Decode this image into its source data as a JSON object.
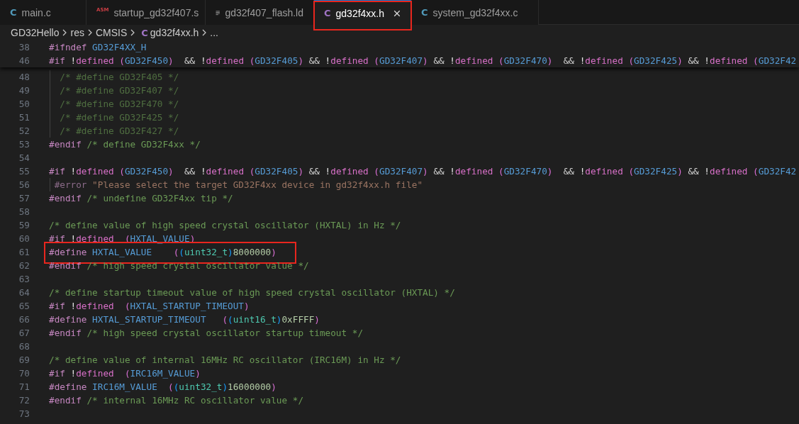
{
  "tabs": [
    {
      "kind": "c-source",
      "icon": "C",
      "label": "main.c",
      "selected": false,
      "annotated": false
    },
    {
      "kind": "asm",
      "icon": "ASM",
      "label": "startup_gd32f407.s",
      "selected": false,
      "annotated": false
    },
    {
      "kind": "linker",
      "label": "gd32f407_flash.ld",
      "selected": false,
      "annotated": false
    },
    {
      "kind": "c-header",
      "icon": "C",
      "label": "gd32f4xx.h",
      "selected": true,
      "annotated": true
    },
    {
      "kind": "c-source",
      "icon": "C",
      "label": "system_gd32f4xx.c",
      "selected": false,
      "annotated": false
    }
  ],
  "breadcrumb": [
    {
      "label": "GD32Hello"
    },
    {
      "label": "res"
    },
    {
      "label": "CMSIS"
    },
    {
      "icon": "C",
      "label": "gd32f4xx.h"
    },
    {
      "label": "..."
    }
  ],
  "sticky_lines": [
    {
      "number": "38",
      "tokens": [
        {
          "kind": "pp",
          "text": "#ifndef "
        },
        {
          "kind": "macro",
          "text": "GD32F4XX_H"
        }
      ]
    },
    {
      "number": "46",
      "tokens": [
        {
          "kind": "pp",
          "text": "#if "
        },
        {
          "kind": "not",
          "text": "!"
        },
        {
          "kind": "fn",
          "text": "defined "
        },
        {
          "kind": "paren",
          "text": "("
        },
        {
          "kind": "macro",
          "text": "GD32F450"
        },
        {
          "kind": "paren",
          "text": ")"
        },
        {
          "kind": "op",
          "text": "  && "
        },
        {
          "kind": "not",
          "text": "!"
        },
        {
          "kind": "fn",
          "text": "defined "
        },
        {
          "kind": "paren",
          "text": "("
        },
        {
          "kind": "macro",
          "text": "GD32F405"
        },
        {
          "kind": "paren",
          "text": ")"
        },
        {
          "kind": "op",
          "text": " && "
        },
        {
          "kind": "not",
          "text": "!"
        },
        {
          "kind": "fn",
          "text": "defined "
        },
        {
          "kind": "paren",
          "text": "("
        },
        {
          "kind": "macro",
          "text": "GD32F407"
        },
        {
          "kind": "paren",
          "text": ")"
        },
        {
          "kind": "op",
          "text": " && "
        },
        {
          "kind": "not",
          "text": "!"
        },
        {
          "kind": "fn",
          "text": "defined "
        },
        {
          "kind": "paren",
          "text": "("
        },
        {
          "kind": "macro",
          "text": "GD32F470"
        },
        {
          "kind": "paren",
          "text": ")"
        },
        {
          "kind": "op",
          "text": "  && "
        },
        {
          "kind": "not",
          "text": "!"
        },
        {
          "kind": "fn",
          "text": "defined "
        },
        {
          "kind": "paren",
          "text": "("
        },
        {
          "kind": "macro",
          "text": "GD32F425"
        },
        {
          "kind": "paren",
          "text": ")"
        },
        {
          "kind": "op",
          "text": " && "
        },
        {
          "kind": "not",
          "text": "!"
        },
        {
          "kind": "fn",
          "text": "defined "
        },
        {
          "kind": "paren",
          "text": "("
        },
        {
          "kind": "macro",
          "text": "GD32F42"
        }
      ]
    }
  ],
  "lines": [
    {
      "number": "48",
      "indent_guide": true,
      "annotated": false,
      "tokens": [
        {
          "kind": "inactive-comment",
          "text": "  /* #define GD32F405 */"
        }
      ]
    },
    {
      "number": "49",
      "indent_guide": true,
      "annotated": false,
      "tokens": [
        {
          "kind": "inactive-comment",
          "text": "  /* #define GD32F407 */"
        }
      ]
    },
    {
      "number": "50",
      "indent_guide": true,
      "annotated": false,
      "tokens": [
        {
          "kind": "inactive-comment",
          "text": "  /* #define GD32F470 */"
        }
      ]
    },
    {
      "number": "51",
      "indent_guide": true,
      "annotated": false,
      "tokens": [
        {
          "kind": "inactive-comment",
          "text": "  /* #define GD32F425 */"
        }
      ]
    },
    {
      "number": "52",
      "indent_guide": true,
      "annotated": false,
      "tokens": [
        {
          "kind": "inactive-comment",
          "text": "  /* #define GD32F427 */"
        }
      ]
    },
    {
      "number": "53",
      "indent_guide": false,
      "annotated": false,
      "tokens": [
        {
          "kind": "pp",
          "text": "#endif "
        },
        {
          "kind": "comment",
          "text": "/* define GD32F4xx */"
        }
      ]
    },
    {
      "number": "54"
    },
    {
      "number": "55",
      "indent_guide": false,
      "annotated": false,
      "tokens": [
        {
          "kind": "pp",
          "text": "#if "
        },
        {
          "kind": "not",
          "text": "!"
        },
        {
          "kind": "fn",
          "text": "defined "
        },
        {
          "kind": "paren",
          "text": "("
        },
        {
          "kind": "macro",
          "text": "GD32F450"
        },
        {
          "kind": "paren",
          "text": ")"
        },
        {
          "kind": "op",
          "text": "  && "
        },
        {
          "kind": "not",
          "text": "!"
        },
        {
          "kind": "fn",
          "text": "defined "
        },
        {
          "kind": "paren",
          "text": "("
        },
        {
          "kind": "macro",
          "text": "GD32F405"
        },
        {
          "kind": "paren",
          "text": ")"
        },
        {
          "kind": "op",
          "text": " && "
        },
        {
          "kind": "not",
          "text": "!"
        },
        {
          "kind": "fn",
          "text": "defined "
        },
        {
          "kind": "paren",
          "text": "("
        },
        {
          "kind": "macro",
          "text": "GD32F407"
        },
        {
          "kind": "paren",
          "text": ")"
        },
        {
          "kind": "op",
          "text": " && "
        },
        {
          "kind": "not",
          "text": "!"
        },
        {
          "kind": "fn",
          "text": "defined "
        },
        {
          "kind": "paren",
          "text": "("
        },
        {
          "kind": "macro",
          "text": "GD32F470"
        },
        {
          "kind": "paren",
          "text": ")"
        },
        {
          "kind": "op",
          "text": "  && "
        },
        {
          "kind": "not",
          "text": "!"
        },
        {
          "kind": "fn",
          "text": "defined "
        },
        {
          "kind": "paren",
          "text": "("
        },
        {
          "kind": "macro",
          "text": "GD32F425"
        },
        {
          "kind": "paren",
          "text": ")"
        },
        {
          "kind": "op",
          "text": " && "
        },
        {
          "kind": "not",
          "text": "!"
        },
        {
          "kind": "fn",
          "text": "defined "
        },
        {
          "kind": "paren",
          "text": "("
        },
        {
          "kind": "macro",
          "text": "GD32F42"
        }
      ]
    },
    {
      "number": "56",
      "indent_guide": true,
      "annotated": false,
      "tokens": [
        {
          "kind": "inactive-pp",
          "text": " #error "
        },
        {
          "kind": "inactive-string",
          "text": "\"Please select the target GD32F4xx device in gd32f4xx.h file\""
        }
      ]
    },
    {
      "number": "57",
      "indent_guide": false,
      "annotated": false,
      "tokens": [
        {
          "kind": "pp",
          "text": "#endif "
        },
        {
          "kind": "comment",
          "text": "/* undefine GD32F4xx tip */"
        }
      ]
    },
    {
      "number": "58"
    },
    {
      "number": "59",
      "indent_guide": false,
      "annotated": false,
      "tokens": [
        {
          "kind": "comment",
          "text": "/* define value of high speed crystal oscillator (HXTAL) in Hz */"
        }
      ]
    },
    {
      "number": "60",
      "indent_guide": false,
      "annotated": false,
      "tokens": [
        {
          "kind": "pp",
          "text": "#if "
        },
        {
          "kind": "not",
          "text": "!"
        },
        {
          "kind": "fn",
          "text": "defined  "
        },
        {
          "kind": "paren",
          "text": "("
        },
        {
          "kind": "macro",
          "text": "HXTAL_VALUE"
        },
        {
          "kind": "paren",
          "text": ")"
        }
      ]
    },
    {
      "number": "61",
      "indent_guide": false,
      "annotated": true,
      "tokens": [
        {
          "kind": "pp",
          "text": "#define "
        },
        {
          "kind": "macro",
          "text": "HXTAL_VALUE    "
        },
        {
          "kind": "paren",
          "text": "("
        },
        {
          "kind": "paren2",
          "text": "("
        },
        {
          "kind": "type",
          "text": "uint32_t"
        },
        {
          "kind": "paren2",
          "text": ")"
        },
        {
          "kind": "num",
          "text": "8000000"
        },
        {
          "kind": "paren",
          "text": ")"
        }
      ]
    },
    {
      "number": "62",
      "indent_guide": false,
      "annotated": false,
      "tokens": [
        {
          "kind": "pp",
          "text": "#endif "
        },
        {
          "kind": "comment",
          "text": "/* high speed crystal oscillator value */"
        }
      ]
    },
    {
      "number": "63"
    },
    {
      "number": "64",
      "indent_guide": false,
      "annotated": false,
      "tokens": [
        {
          "kind": "comment",
          "text": "/* define startup timeout value of high speed crystal oscillator (HXTAL) */"
        }
      ]
    },
    {
      "number": "65",
      "indent_guide": false,
      "annotated": false,
      "tokens": [
        {
          "kind": "pp",
          "text": "#if "
        },
        {
          "kind": "not",
          "text": "!"
        },
        {
          "kind": "fn",
          "text": "defined  "
        },
        {
          "kind": "paren",
          "text": "("
        },
        {
          "kind": "macro",
          "text": "HXTAL_STARTUP_TIMEOUT"
        },
        {
          "kind": "paren",
          "text": ")"
        }
      ]
    },
    {
      "number": "66",
      "indent_guide": false,
      "annotated": false,
      "tokens": [
        {
          "kind": "pp",
          "text": "#define "
        },
        {
          "kind": "macro",
          "text": "HXTAL_STARTUP_TIMEOUT   "
        },
        {
          "kind": "paren",
          "text": "("
        },
        {
          "kind": "paren2",
          "text": "("
        },
        {
          "kind": "type",
          "text": "uint16_t"
        },
        {
          "kind": "paren2",
          "text": ")"
        },
        {
          "kind": "num",
          "text": "0xFFFF"
        },
        {
          "kind": "paren",
          "text": ")"
        }
      ]
    },
    {
      "number": "67",
      "indent_guide": false,
      "annotated": false,
      "tokens": [
        {
          "kind": "pp",
          "text": "#endif "
        },
        {
          "kind": "comment",
          "text": "/* high speed crystal oscillator startup timeout */"
        }
      ]
    },
    {
      "number": "68"
    },
    {
      "number": "69",
      "indent_guide": false,
      "annotated": false,
      "tokens": [
        {
          "kind": "comment",
          "text": "/* define value of internal 16MHz RC oscillator (IRC16M) in Hz */"
        }
      ]
    },
    {
      "number": "70",
      "indent_guide": false,
      "annotated": false,
      "tokens": [
        {
          "kind": "pp",
          "text": "#if "
        },
        {
          "kind": "not",
          "text": "!"
        },
        {
          "kind": "fn",
          "text": "defined  "
        },
        {
          "kind": "paren",
          "text": "("
        },
        {
          "kind": "macro",
          "text": "IRC16M_VALUE"
        },
        {
          "kind": "paren",
          "text": ")"
        }
      ]
    },
    {
      "number": "71",
      "indent_guide": false,
      "annotated": false,
      "tokens": [
        {
          "kind": "pp",
          "text": "#define "
        },
        {
          "kind": "macro",
          "text": "IRC16M_VALUE  "
        },
        {
          "kind": "paren",
          "text": "("
        },
        {
          "kind": "paren2",
          "text": "("
        },
        {
          "kind": "type",
          "text": "uint32_t"
        },
        {
          "kind": "paren2",
          "text": ")"
        },
        {
          "kind": "num",
          "text": "16000000"
        },
        {
          "kind": "paren",
          "text": ")"
        }
      ]
    },
    {
      "number": "72",
      "indent_guide": false,
      "annotated": false,
      "tokens": [
        {
          "kind": "pp",
          "text": "#endif "
        },
        {
          "kind": "comment",
          "text": "/* internal 16MHz RC oscillator value */"
        }
      ]
    },
    {
      "number": "73"
    }
  ]
}
